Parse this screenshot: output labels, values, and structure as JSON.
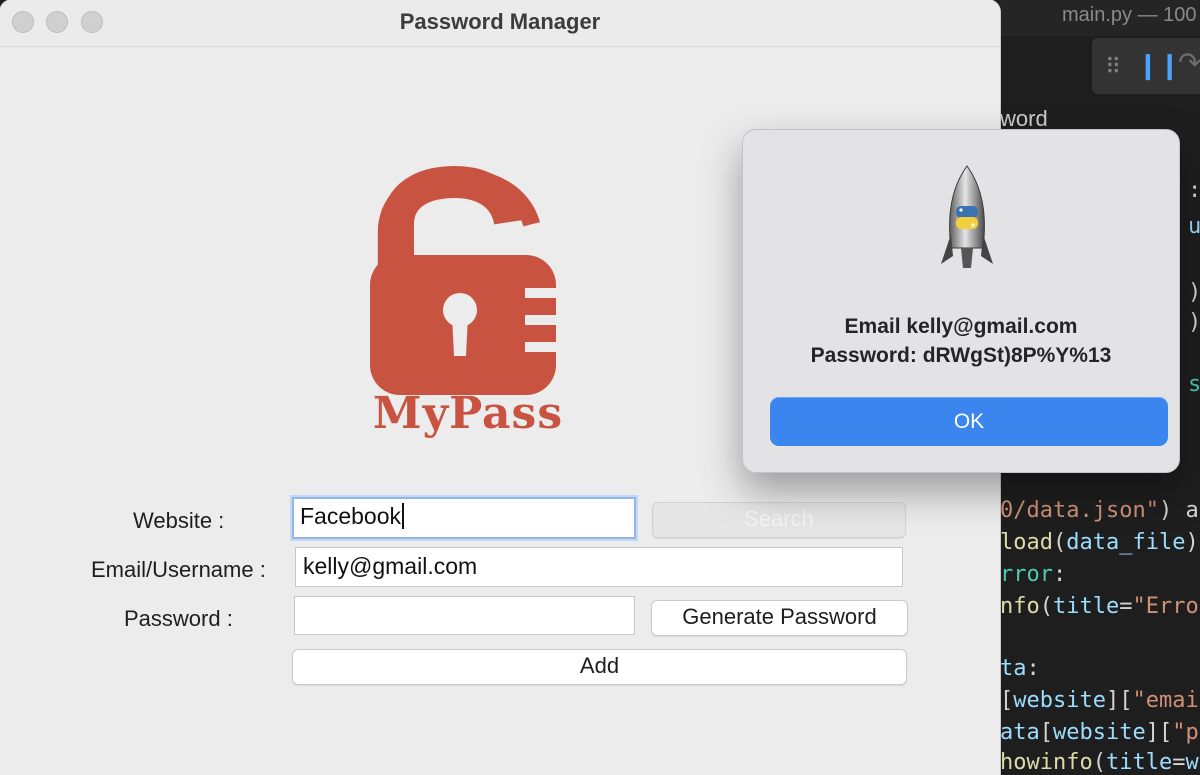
{
  "editor": {
    "title": "main.py — 100",
    "breadcrumb_fragment": "word",
    "code_fragments": {
      "line1_str": "0/data.json\"",
      "line1_rest": ") as",
      "line2_fn": "load",
      "line2_var": "data_file",
      "line2_rest": ")",
      "line3_cls": "rror",
      "line3_rest": ":",
      "line4_fn": "nfo",
      "line4_var": "title",
      "line4_str": "\"Error",
      "line5_var": "ta",
      "line5_rest": ":",
      "line6_var": "website",
      "line6_str": "\"email",
      "line7_var1": "ata",
      "line7_var2": "website",
      "line7_str": "\"pa",
      "line8_fn": "howinfo",
      "line8_var1": "title",
      "line8_var2": "we"
    },
    "right_edge_fragments": {
      "f1": ")",
      "f2": ")",
      "f3": "s"
    }
  },
  "window": {
    "title": "Password Manager"
  },
  "logo": {
    "text": "MyPass",
    "color": "#c85341"
  },
  "form": {
    "website_label": "Website :",
    "website_value": "Facebook",
    "search_button": "Search",
    "email_label": "Email/Username :",
    "email_value": "kelly@gmail.com",
    "password_label": "Password :",
    "password_value": "",
    "generate_button": "Generate Password",
    "add_button": "Add"
  },
  "dialog": {
    "line1": "Email kelly@gmail.com",
    "line2": "Password: dRWgSt)8P%Y%13",
    "ok_button": "OK",
    "accent_color": "#3a86ee"
  }
}
